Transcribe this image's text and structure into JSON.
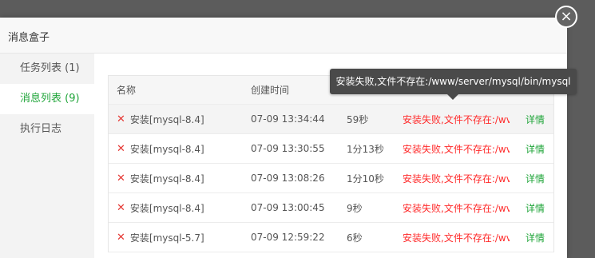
{
  "dialog": {
    "title": "消息盒子",
    "close_icon": "×"
  },
  "sidebar": {
    "items": [
      {
        "label": "任务列表 (1)"
      },
      {
        "label": "消息列表 (9)"
      },
      {
        "label": "执行日志"
      }
    ]
  },
  "table": {
    "headers": {
      "name": "名称",
      "time": "创建时间"
    },
    "rows": [
      {
        "name": "安装[mysql-8.4]",
        "time": "07-09 13:34:44",
        "duration": "59秒",
        "status": "安装失败,文件不存在:/wv",
        "action": "详情"
      },
      {
        "name": "安装[mysql-8.4]",
        "time": "07-09 13:30:55",
        "duration": "1分13秒",
        "status": "安装失败,文件不存在:/wv",
        "action": "详情"
      },
      {
        "name": "安装[mysql-8.4]",
        "time": "07-09 13:08:26",
        "duration": "1分10秒",
        "status": "安装失败,文件不存在:/wv",
        "action": "详情"
      },
      {
        "name": "安装[mysql-8.4]",
        "time": "07-09 13:00:45",
        "duration": "9秒",
        "status": "安装失败,文件不存在:/wv",
        "action": "详情"
      },
      {
        "name": "安装[mysql-5.7]",
        "time": "07-09 12:59:22",
        "duration": "6秒",
        "status": "安装失败,文件不存在:/wv",
        "action": "详情"
      }
    ]
  },
  "tooltip": {
    "text": "安装失败,文件不存在:/www/server/mysql/bin/mysql"
  },
  "colors": {
    "accent_green": "#20a53a",
    "error_red": "#ff2b2b"
  }
}
